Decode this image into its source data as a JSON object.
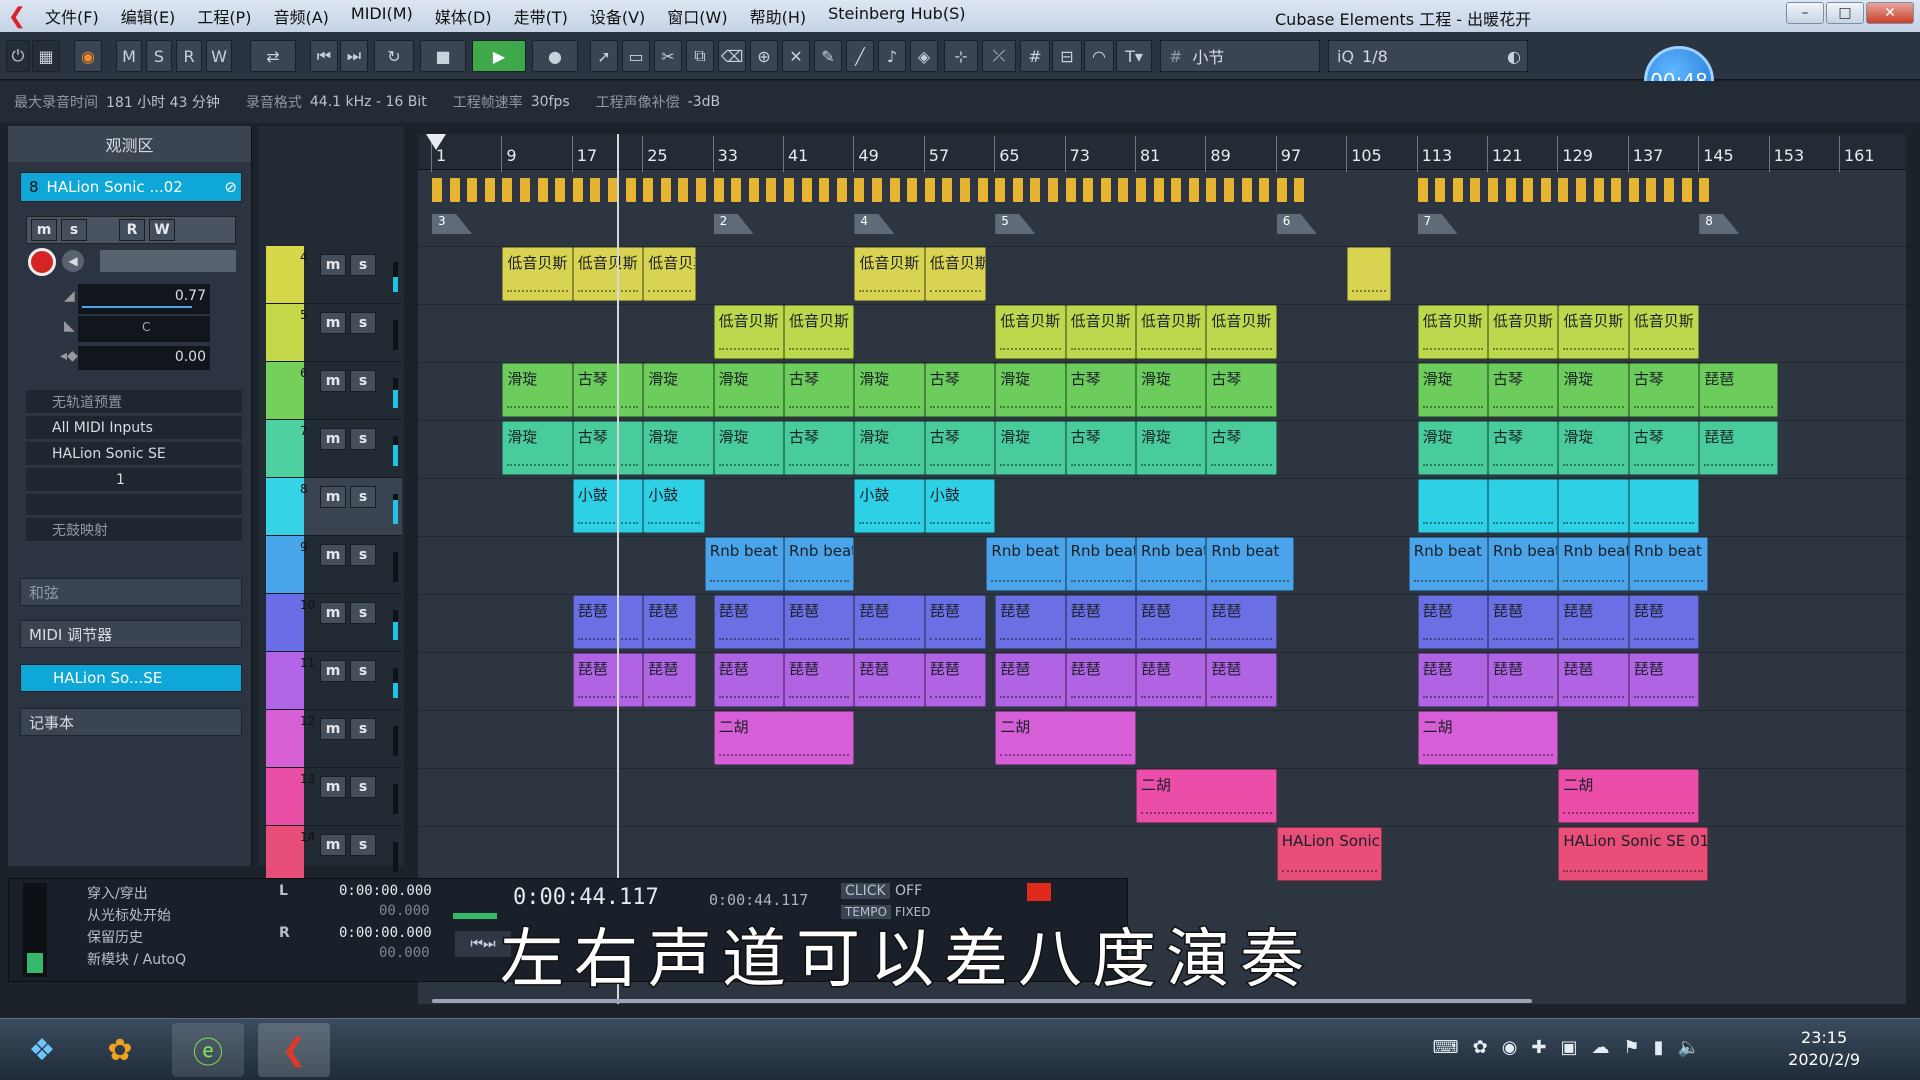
{
  "window": {
    "title": "Cubase Elements 工程 - 出暖花开",
    "menu": [
      "文件(F)",
      "编辑(E)",
      "工程(P)",
      "音频(A)",
      "MIDI(M)",
      "媒体(D)",
      "走带(T)",
      "设备(V)",
      "窗口(W)",
      "帮助(H)",
      "Steinberg Hub(S)"
    ],
    "controls": [
      "–",
      "□",
      "✕"
    ]
  },
  "toolbar": {
    "mode_letters": [
      "M",
      "S",
      "R",
      "W"
    ],
    "snap_label": "小节",
    "quantize_label": "1/8",
    "quantize_prefix": "iQ",
    "time_bubble": "00:48"
  },
  "infobar": {
    "max_record_label": "最大录音时间",
    "max_record_value": "181 小时 43 分钟",
    "record_format_label": "录音格式",
    "record_format_value": "44.1 kHz - 16 Bit",
    "frame_rate_label": "工程帧速率",
    "frame_rate_value": "30fps",
    "pan_label": "工程声像补偿",
    "pan_value": "-3dB"
  },
  "inspector": {
    "title": "观测区",
    "track_number": "8",
    "track_name": "HALion Sonic ...02",
    "volume": "0.77",
    "pan": "C",
    "delay": "0.00",
    "preset": "无轨道预置",
    "input": "All MIDI Inputs",
    "output": "HALion Sonic SE",
    "channel": "1",
    "no_map": "无鼓映射",
    "section_chord": "和弦",
    "section_midi": "MIDI 调节器",
    "section_instrument": "HALion So...SE",
    "section_notepad": "记事本"
  },
  "tracks": [
    {
      "num": "4",
      "color": "#d6d84a",
      "meter": 0.5
    },
    {
      "num": "5",
      "color": "#c5d84a",
      "meter": 0.0
    },
    {
      "num": "6",
      "color": "#74d05a",
      "meter": 0.6
    },
    {
      "num": "7",
      "color": "#4ed0a0",
      "meter": 0.7
    },
    {
      "num": "8",
      "color": "#36d2e6",
      "meter": 0.8
    },
    {
      "num": "9",
      "color": "#4aa6ea",
      "meter": 0.0
    },
    {
      "num": "10",
      "color": "#6a6ee6",
      "meter": 0.6
    },
    {
      "num": "11",
      "color": "#b264e6",
      "meter": 0.5
    },
    {
      "num": "12",
      "color": "#d860d6",
      "meter": 0.0
    },
    {
      "num": "13",
      "color": "#ea4fa6",
      "meter": 0.0
    },
    {
      "num": "14",
      "color": "#e84e7a",
      "meter": 0.0
    }
  ],
  "ruler": [
    "1",
    "9",
    "17",
    "25",
    "33",
    "41",
    "49",
    "57",
    "65",
    "73",
    "81",
    "89",
    "97",
    "105",
    "113",
    "121",
    "129",
    "137",
    "145",
    "153",
    "161"
  ],
  "markers": [
    {
      "label": "3",
      "bar": 1
    },
    {
      "label": "2",
      "bar": 33
    },
    {
      "label": "4",
      "bar": 49
    },
    {
      "label": "5",
      "bar": 65
    },
    {
      "label": "6",
      "bar": 97
    },
    {
      "label": "7",
      "bar": 113
    },
    {
      "label": "8",
      "bar": 145
    }
  ],
  "lanes": [
    {
      "color": "#d8d452",
      "parts": [
        {
          "s": 9,
          "e": 17,
          "t": "低音贝斯"
        },
        {
          "s": 17,
          "e": 25,
          "t": "低音贝斯"
        },
        {
          "s": 25,
          "e": 31,
          "t": "低音贝斯"
        },
        {
          "s": 49,
          "e": 57,
          "t": "低音贝斯"
        },
        {
          "s": 57,
          "e": 64,
          "t": "低音贝斯"
        },
        {
          "s": 105,
          "e": 110,
          "t": ""
        }
      ]
    },
    {
      "color": "#bcd84c",
      "parts": [
        {
          "s": 33,
          "e": 41,
          "t": "低音贝斯"
        },
        {
          "s": 41,
          "e": 49,
          "t": "低音贝斯"
        },
        {
          "s": 65,
          "e": 73,
          "t": "低音贝斯"
        },
        {
          "s": 73,
          "e": 81,
          "t": "低音贝斯"
        },
        {
          "s": 81,
          "e": 89,
          "t": "低音贝斯"
        },
        {
          "s": 89,
          "e": 97,
          "t": "低音贝斯"
        },
        {
          "s": 113,
          "e": 121,
          "t": "低音贝斯"
        },
        {
          "s": 121,
          "e": 129,
          "t": "低音贝斯"
        },
        {
          "s": 129,
          "e": 137,
          "t": "低音贝斯"
        },
        {
          "s": 137,
          "e": 145,
          "t": "低音贝斯"
        }
      ]
    },
    {
      "color": "#6ccc5c",
      "parts": [
        {
          "s": 9,
          "e": 17,
          "t": "滑琁"
        },
        {
          "s": 17,
          "e": 25,
          "t": "古琴"
        },
        {
          "s": 25,
          "e": 33,
          "t": "滑琁"
        },
        {
          "s": 33,
          "e": 41,
          "t": "滑琁"
        },
        {
          "s": 41,
          "e": 49,
          "t": "古琴"
        },
        {
          "s": 49,
          "e": 57,
          "t": "滑琁"
        },
        {
          "s": 57,
          "e": 65,
          "t": "古琴"
        },
        {
          "s": 65,
          "e": 73,
          "t": "滑琁"
        },
        {
          "s": 73,
          "e": 81,
          "t": "古琴"
        },
        {
          "s": 81,
          "e": 89,
          "t": "滑琁"
        },
        {
          "s": 89,
          "e": 97,
          "t": "古琴"
        },
        {
          "s": 113,
          "e": 121,
          "t": "滑琁"
        },
        {
          "s": 121,
          "e": 129,
          "t": "古琴"
        },
        {
          "s": 129,
          "e": 137,
          "t": "滑琁"
        },
        {
          "s": 137,
          "e": 145,
          "t": "古琴"
        },
        {
          "s": 145,
          "e": 154,
          "t": "琵琶"
        }
      ]
    },
    {
      "color": "#48cc9c",
      "parts": [
        {
          "s": 9,
          "e": 17,
          "t": "滑琁"
        },
        {
          "s": 17,
          "e": 25,
          "t": "古琴"
        },
        {
          "s": 25,
          "e": 33,
          "t": "滑琁"
        },
        {
          "s": 33,
          "e": 41,
          "t": "滑琁"
        },
        {
          "s": 41,
          "e": 49,
          "t": "古琴"
        },
        {
          "s": 49,
          "e": 57,
          "t": "滑琁"
        },
        {
          "s": 57,
          "e": 65,
          "t": "古琴"
        },
        {
          "s": 65,
          "e": 73,
          "t": "滑琁"
        },
        {
          "s": 73,
          "e": 81,
          "t": "古琴"
        },
        {
          "s": 81,
          "e": 89,
          "t": "滑琁"
        },
        {
          "s": 89,
          "e": 97,
          "t": "古琴"
        },
        {
          "s": 113,
          "e": 121,
          "t": "滑琁"
        },
        {
          "s": 121,
          "e": 129,
          "t": "古琴"
        },
        {
          "s": 129,
          "e": 137,
          "t": "滑琁"
        },
        {
          "s": 137,
          "e": 145,
          "t": "古琴"
        },
        {
          "s": 145,
          "e": 154,
          "t": "琵琶"
        }
      ]
    },
    {
      "color": "#2ed0e6",
      "parts": [
        {
          "s": 17,
          "e": 25,
          "t": "小鼓"
        },
        {
          "s": 25,
          "e": 32,
          "t": "小鼓"
        },
        {
          "s": 49,
          "e": 57,
          "t": "小鼓"
        },
        {
          "s": 57,
          "e": 65,
          "t": "小鼓"
        },
        {
          "s": 113,
          "e": 121,
          "t": ""
        },
        {
          "s": 121,
          "e": 129,
          "t": ""
        },
        {
          "s": 129,
          "e": 137,
          "t": ""
        },
        {
          "s": 137,
          "e": 145,
          "t": ""
        }
      ]
    },
    {
      "color": "#4aa4ea",
      "parts": [
        {
          "s": 32,
          "e": 41,
          "t": "Rnb beat"
        },
        {
          "s": 41,
          "e": 49,
          "t": "Rnb beat"
        },
        {
          "s": 64,
          "e": 73,
          "t": "Rnb beat"
        },
        {
          "s": 73,
          "e": 81,
          "t": "Rnb beat"
        },
        {
          "s": 81,
          "e": 89,
          "t": "Rnb beat"
        },
        {
          "s": 89,
          "e": 99,
          "t": "Rnb beat"
        },
        {
          "s": 112,
          "e": 121,
          "t": "Rnb beat"
        },
        {
          "s": 121,
          "e": 129,
          "t": "Rnb beat"
        },
        {
          "s": 129,
          "e": 137,
          "t": "Rnb beat"
        },
        {
          "s": 137,
          "e": 146,
          "t": "Rnb beat"
        }
      ]
    },
    {
      "color": "#6a70e4",
      "parts": [
        {
          "s": 17,
          "e": 25,
          "t": "琵琶"
        },
        {
          "s": 25,
          "e": 31,
          "t": "琵琶"
        },
        {
          "s": 33,
          "e": 41,
          "t": "琵琶"
        },
        {
          "s": 41,
          "e": 49,
          "t": "琵琶"
        },
        {
          "s": 49,
          "e": 57,
          "t": "琵琶"
        },
        {
          "s": 57,
          "e": 64,
          "t": "琵琶"
        },
        {
          "s": 65,
          "e": 73,
          "t": "琵琶"
        },
        {
          "s": 73,
          "e": 81,
          "t": "琵琶"
        },
        {
          "s": 81,
          "e": 89,
          "t": "琵琶"
        },
        {
          "s": 89,
          "e": 97,
          "t": "琵琶"
        },
        {
          "s": 113,
          "e": 121,
          "t": "琵琶"
        },
        {
          "s": 121,
          "e": 129,
          "t": "琵琶"
        },
        {
          "s": 129,
          "e": 137,
          "t": "琵琶"
        },
        {
          "s": 137,
          "e": 145,
          "t": "琵琶"
        }
      ]
    },
    {
      "color": "#b064e4",
      "parts": [
        {
          "s": 17,
          "e": 25,
          "t": "琵琶"
        },
        {
          "s": 25,
          "e": 31,
          "t": "琵琶"
        },
        {
          "s": 33,
          "e": 41,
          "t": "琵琶"
        },
        {
          "s": 41,
          "e": 49,
          "t": "琵琶"
        },
        {
          "s": 49,
          "e": 57,
          "t": "琵琶"
        },
        {
          "s": 57,
          "e": 64,
          "t": "琵琶"
        },
        {
          "s": 65,
          "e": 73,
          "t": "琵琶"
        },
        {
          "s": 73,
          "e": 81,
          "t": "琵琶"
        },
        {
          "s": 81,
          "e": 89,
          "t": "琵琶"
        },
        {
          "s": 89,
          "e": 97,
          "t": "琵琶"
        },
        {
          "s": 113,
          "e": 121,
          "t": "琵琶"
        },
        {
          "s": 121,
          "e": 129,
          "t": "琵琶"
        },
        {
          "s": 129,
          "e": 137,
          "t": "琵琶"
        },
        {
          "s": 137,
          "e": 145,
          "t": "琵琶"
        }
      ]
    },
    {
      "color": "#d65ed6",
      "parts": [
        {
          "s": 33,
          "e": 49,
          "t": "二胡"
        },
        {
          "s": 65,
          "e": 81,
          "t": "二胡"
        },
        {
          "s": 113,
          "e": 129,
          "t": "二胡"
        }
      ]
    },
    {
      "color": "#ea4ea8",
      "parts": [
        {
          "s": 81,
          "e": 97,
          "t": "二胡"
        },
        {
          "s": 129,
          "e": 145,
          "t": "二胡"
        }
      ]
    },
    {
      "color": "#e84e78",
      "parts": [
        {
          "s": 97,
          "e": 109,
          "t": "HALion Sonic"
        },
        {
          "s": 129,
          "e": 146,
          "t": "HALion Sonic SE 01"
        }
      ]
    }
  ],
  "transport": {
    "punch_in": "穿入/穿出",
    "from_cursor": "从光标处开始",
    "keep_history": "保留历史",
    "new_part": "新模块 / AutoQ",
    "loc_left": "0:00:00.000",
    "loc_right_sub": "00.000",
    "loc_r": "0:00:00.000",
    "loc_r_sub": "00.000",
    "main_time": "0:00:44.117",
    "sub_time": "0:00:44.117",
    "click": "CLICK",
    "click_state": "OFF",
    "tempo": "TEMPO",
    "tempo_state": "FIXED",
    "letters": [
      "L",
      "R"
    ]
  },
  "subtitle": "左右声道可以差八度演奏",
  "taskbar": {
    "time": "23:15",
    "date": "2020/2/9"
  }
}
